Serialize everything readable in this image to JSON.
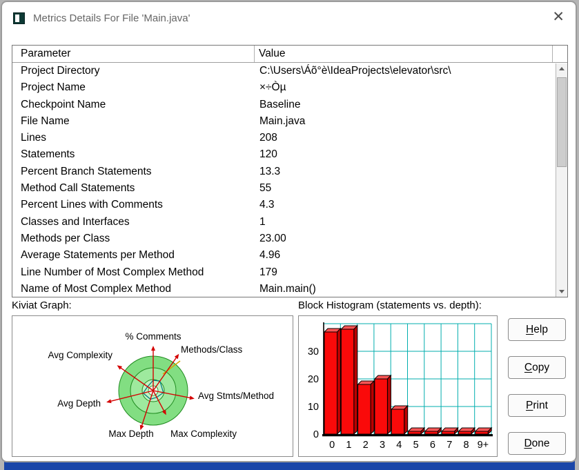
{
  "window": {
    "title": "Metrics Details For File 'Main.java'",
    "close_glyph": "✕"
  },
  "table": {
    "columns": [
      "Parameter",
      "Value"
    ],
    "rows": [
      [
        "Project Directory",
        "C:\\Users\\Áõ°è\\IdeaProjects\\elevator\\src\\"
      ],
      [
        "Project Name",
        "×÷Òµ"
      ],
      [
        "Checkpoint Name",
        "Baseline"
      ],
      [
        "File Name",
        "Main.java"
      ],
      [
        "Lines",
        "208"
      ],
      [
        "Statements",
        "120"
      ],
      [
        "Percent Branch Statements",
        "13.3"
      ],
      [
        "Method Call Statements",
        "55"
      ],
      [
        "Percent Lines with Comments",
        "4.3"
      ],
      [
        "Classes and Interfaces",
        "1"
      ],
      [
        "Methods per Class",
        "23.00"
      ],
      [
        "Average Statements per Method",
        "4.96"
      ],
      [
        "Line Number of Most Complex Method",
        "179"
      ],
      [
        "Name of Most Complex Method",
        "Main.main()"
      ]
    ]
  },
  "sections": {
    "kiviat_label": "Kiviat Graph:",
    "histogram_label": "Block Histogram (statements vs. depth):"
  },
  "buttons": [
    {
      "mnemonic": "H",
      "rest": "elp"
    },
    {
      "mnemonic": "C",
      "rest": "opy"
    },
    {
      "mnemonic": "P",
      "rest": "rint"
    },
    {
      "mnemonic": "D",
      "rest": "one"
    }
  ],
  "chart_data": [
    {
      "type": "radar",
      "title": "Kiviat Graph",
      "axes": [
        {
          "label": "% Comments",
          "arrow": 1.3,
          "value": 0.3
        },
        {
          "label": "Methods/Class",
          "arrow": 1.3,
          "value": 0.34
        },
        {
          "label": "Avg Stmts/Method",
          "arrow": 1.22,
          "value": 0.3
        },
        {
          "label": "Max Complexity",
          "arrow": 0.8,
          "value": 0.22
        },
        {
          "label": "Max Depth",
          "arrow": 1.2,
          "value": 0.26
        },
        {
          "label": "Avg Depth",
          "arrow": 1.4,
          "value": 0.3
        },
        {
          "label": "Avg Complexity",
          "arrow": 1.28,
          "value": 0.2
        }
      ],
      "rings": [
        1.0,
        0.66,
        0.32
      ],
      "colors": {
        "disc": [
          "#82de82",
          "#9ee99e",
          "#c2f1c2"
        ],
        "ring": "#1e8a1e",
        "arrow": "#d40000",
        "inner_polygon": "#008080",
        "highlight": "#d9a400"
      }
    },
    {
      "type": "bar",
      "title": "Block Histogram (statements vs. depth)",
      "categories": [
        "0",
        "1",
        "2",
        "3",
        "4",
        "5",
        "6",
        "7",
        "8",
        "9+"
      ],
      "values": [
        37,
        38,
        18,
        20,
        9,
        1,
        1,
        1,
        1,
        1
      ],
      "xlabel": "depth",
      "ylabel": "statements",
      "ylim": [
        0,
        40
      ],
      "yticks": [
        0,
        10,
        20,
        30
      ],
      "grid": true,
      "colors": {
        "bar_front": "#fa0a0a",
        "bar_top": "#ff5555",
        "bar_side": "#bb0000",
        "grid": "#00aeae",
        "axis": "#000000"
      }
    }
  ]
}
